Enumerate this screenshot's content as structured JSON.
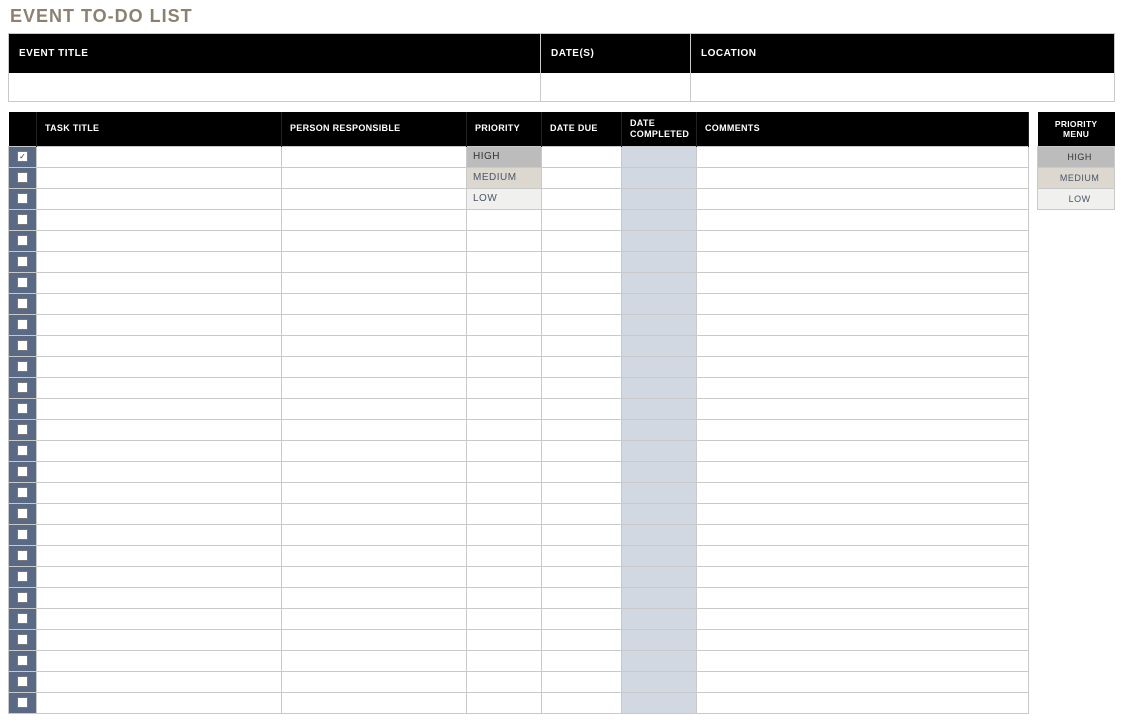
{
  "page_title": "EVENT TO-DO LIST",
  "event_header": {
    "title_label": "EVENT TITLE",
    "dates_label": "DATE(S)",
    "location_label": "LOCATION",
    "title_value": "",
    "dates_value": "",
    "location_value": ""
  },
  "task_headers": {
    "check": "",
    "task_title": "TASK TITLE",
    "person": "PERSON RESPONSIBLE",
    "priority": "PRIORITY",
    "date_due": "DATE DUE",
    "date_completed": "DATE COMPLETED",
    "comments": "COMMENTS"
  },
  "rows": [
    {
      "checked": true,
      "task_title": "",
      "person": "",
      "priority": "HIGH",
      "date_due": "",
      "date_completed": "",
      "comments": ""
    },
    {
      "checked": false,
      "task_title": "",
      "person": "",
      "priority": "MEDIUM",
      "date_due": "",
      "date_completed": "",
      "comments": ""
    },
    {
      "checked": false,
      "task_title": "",
      "person": "",
      "priority": "LOW",
      "date_due": "",
      "date_completed": "",
      "comments": ""
    },
    {
      "checked": false,
      "task_title": "",
      "person": "",
      "priority": "",
      "date_due": "",
      "date_completed": "",
      "comments": ""
    },
    {
      "checked": false,
      "task_title": "",
      "person": "",
      "priority": "",
      "date_due": "",
      "date_completed": "",
      "comments": ""
    },
    {
      "checked": false,
      "task_title": "",
      "person": "",
      "priority": "",
      "date_due": "",
      "date_completed": "",
      "comments": ""
    },
    {
      "checked": false,
      "task_title": "",
      "person": "",
      "priority": "",
      "date_due": "",
      "date_completed": "",
      "comments": ""
    },
    {
      "checked": false,
      "task_title": "",
      "person": "",
      "priority": "",
      "date_due": "",
      "date_completed": "",
      "comments": ""
    },
    {
      "checked": false,
      "task_title": "",
      "person": "",
      "priority": "",
      "date_due": "",
      "date_completed": "",
      "comments": ""
    },
    {
      "checked": false,
      "task_title": "",
      "person": "",
      "priority": "",
      "date_due": "",
      "date_completed": "",
      "comments": ""
    },
    {
      "checked": false,
      "task_title": "",
      "person": "",
      "priority": "",
      "date_due": "",
      "date_completed": "",
      "comments": ""
    },
    {
      "checked": false,
      "task_title": "",
      "person": "",
      "priority": "",
      "date_due": "",
      "date_completed": "",
      "comments": ""
    },
    {
      "checked": false,
      "task_title": "",
      "person": "",
      "priority": "",
      "date_due": "",
      "date_completed": "",
      "comments": ""
    },
    {
      "checked": false,
      "task_title": "",
      "person": "",
      "priority": "",
      "date_due": "",
      "date_completed": "",
      "comments": ""
    },
    {
      "checked": false,
      "task_title": "",
      "person": "",
      "priority": "",
      "date_due": "",
      "date_completed": "",
      "comments": ""
    },
    {
      "checked": false,
      "task_title": "",
      "person": "",
      "priority": "",
      "date_due": "",
      "date_completed": "",
      "comments": ""
    },
    {
      "checked": false,
      "task_title": "",
      "person": "",
      "priority": "",
      "date_due": "",
      "date_completed": "",
      "comments": ""
    },
    {
      "checked": false,
      "task_title": "",
      "person": "",
      "priority": "",
      "date_due": "",
      "date_completed": "",
      "comments": ""
    },
    {
      "checked": false,
      "task_title": "",
      "person": "",
      "priority": "",
      "date_due": "",
      "date_completed": "",
      "comments": ""
    },
    {
      "checked": false,
      "task_title": "",
      "person": "",
      "priority": "",
      "date_due": "",
      "date_completed": "",
      "comments": ""
    },
    {
      "checked": false,
      "task_title": "",
      "person": "",
      "priority": "",
      "date_due": "",
      "date_completed": "",
      "comments": ""
    },
    {
      "checked": false,
      "task_title": "",
      "person": "",
      "priority": "",
      "date_due": "",
      "date_completed": "",
      "comments": ""
    },
    {
      "checked": false,
      "task_title": "",
      "person": "",
      "priority": "",
      "date_due": "",
      "date_completed": "",
      "comments": ""
    },
    {
      "checked": false,
      "task_title": "",
      "person": "",
      "priority": "",
      "date_due": "",
      "date_completed": "",
      "comments": ""
    },
    {
      "checked": false,
      "task_title": "",
      "person": "",
      "priority": "",
      "date_due": "",
      "date_completed": "",
      "comments": ""
    },
    {
      "checked": false,
      "task_title": "",
      "person": "",
      "priority": "",
      "date_due": "",
      "date_completed": "",
      "comments": ""
    },
    {
      "checked": false,
      "task_title": "",
      "person": "",
      "priority": "",
      "date_due": "",
      "date_completed": "",
      "comments": ""
    }
  ],
  "priority_menu": {
    "header": "PRIORITY MENU",
    "options": [
      "HIGH",
      "MEDIUM",
      "LOW"
    ]
  },
  "priority_classes": {
    "HIGH": "prio-high",
    "MEDIUM": "prio-medium",
    "LOW": "prio-low"
  }
}
